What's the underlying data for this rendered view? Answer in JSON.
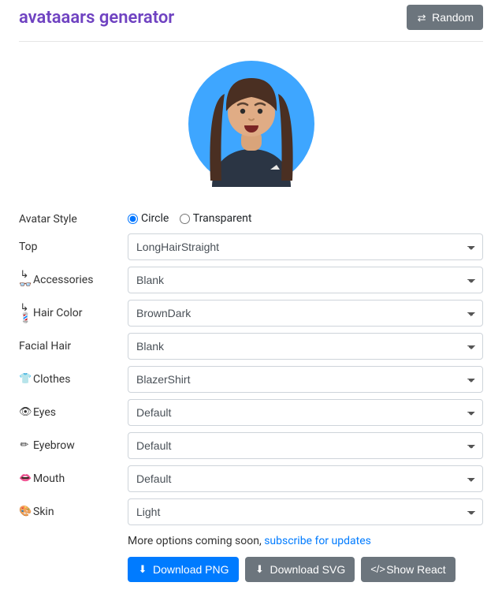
{
  "header": {
    "title": "avataaars generator",
    "random_label": "Random"
  },
  "style_radio": {
    "label": "Avatar Style",
    "circle": "Circle",
    "transparent": "Transparent",
    "selected": "Circle"
  },
  "fields": {
    "top": {
      "label": "Top",
      "value": "LongHairStraight"
    },
    "accessories": {
      "icon": "↳ 👓",
      "label": "Accessories",
      "value": "Blank"
    },
    "hair_color": {
      "icon": "↳ 💈",
      "label": "Hair Color",
      "value": "BrownDark"
    },
    "facial_hair": {
      "label": "Facial Hair",
      "value": "Blank"
    },
    "clothes": {
      "icon": "👕",
      "label": "Clothes",
      "value": "BlazerShirt"
    },
    "eyes": {
      "icon": "👁",
      "label": "Eyes",
      "value": "Default"
    },
    "eyebrow": {
      "icon": "✏",
      "label": "Eyebrow",
      "value": "Default"
    },
    "mouth": {
      "icon": "👄",
      "label": "Mouth",
      "value": "Default"
    },
    "skin": {
      "icon": "🎨",
      "label": "Skin",
      "value": "Light"
    }
  },
  "footer": {
    "more_text": "More options coming soon, ",
    "subscribe_link": "subscribe for updates",
    "download_png": "Download PNG",
    "download_svg": "Download SVG",
    "show_react": "Show React"
  }
}
